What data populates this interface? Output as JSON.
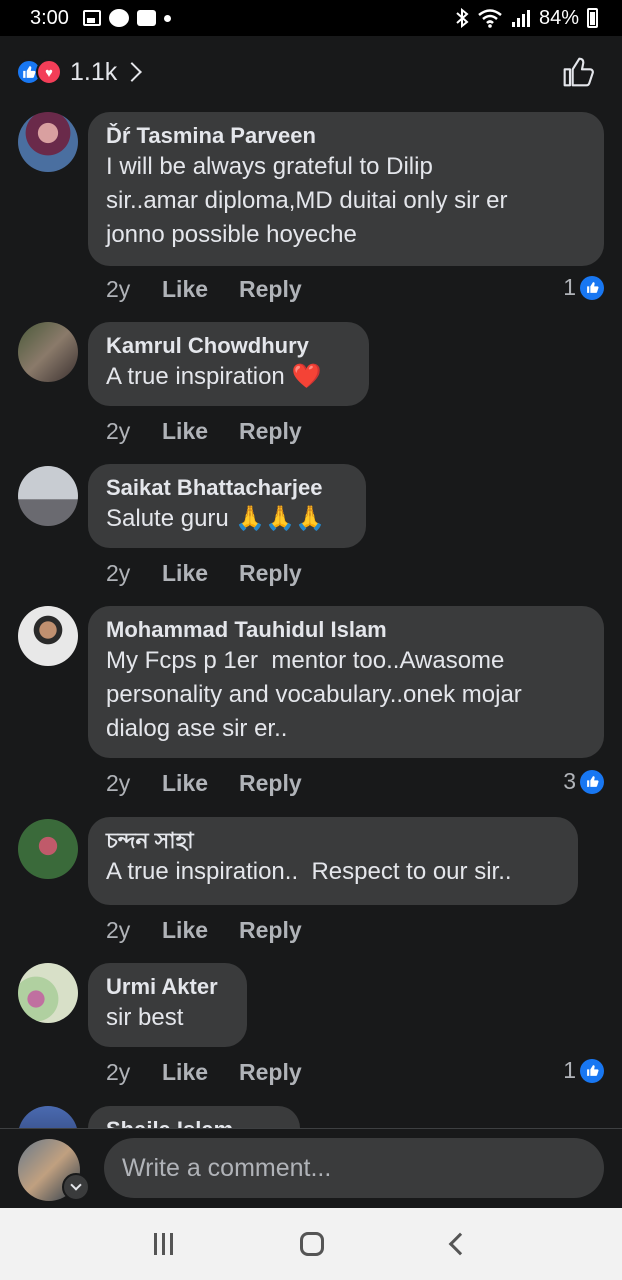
{
  "status_bar": {
    "time": "3:00",
    "battery": "84%"
  },
  "header": {
    "reaction_count": "1.1k"
  },
  "comments": [
    {
      "name": "Ďŕ Tasmina Parveen",
      "text": "I will be always grateful to Dilip\nsir..amar diploma,MD duitai only sir er\njonno possible hoyeche",
      "age": "2y",
      "like": "Like",
      "reply": "Reply",
      "likes": "1"
    },
    {
      "name": "Kamrul Chowdhury",
      "text": "A true inspiration ❤️",
      "age": "2y",
      "like": "Like",
      "reply": "Reply"
    },
    {
      "name": "Saikat Bhattacharjee",
      "text": "Salute guru 🙏🙏🙏",
      "age": "2y",
      "like": "Like",
      "reply": "Reply"
    },
    {
      "name": "Mohammad Tauhidul Islam",
      "text": "My Fcps p 1er  mentor too..Awasome\npersonality and vocabulary..onek mojar\ndialog ase sir er..",
      "age": "2y",
      "like": "Like",
      "reply": "Reply",
      "likes": "3"
    },
    {
      "name": "চন্দন সাহা",
      "text": "A true inspiration..  Respect to our sir..",
      "age": "2y",
      "like": "Like",
      "reply": "Reply"
    },
    {
      "name": "Urmi Akter",
      "text": "sir best",
      "age": "2y",
      "like": "Like",
      "reply": "Reply",
      "likes": "1"
    },
    {
      "name": "Shaila Islam"
    }
  ],
  "composer": {
    "placeholder": "Write a comment..."
  }
}
